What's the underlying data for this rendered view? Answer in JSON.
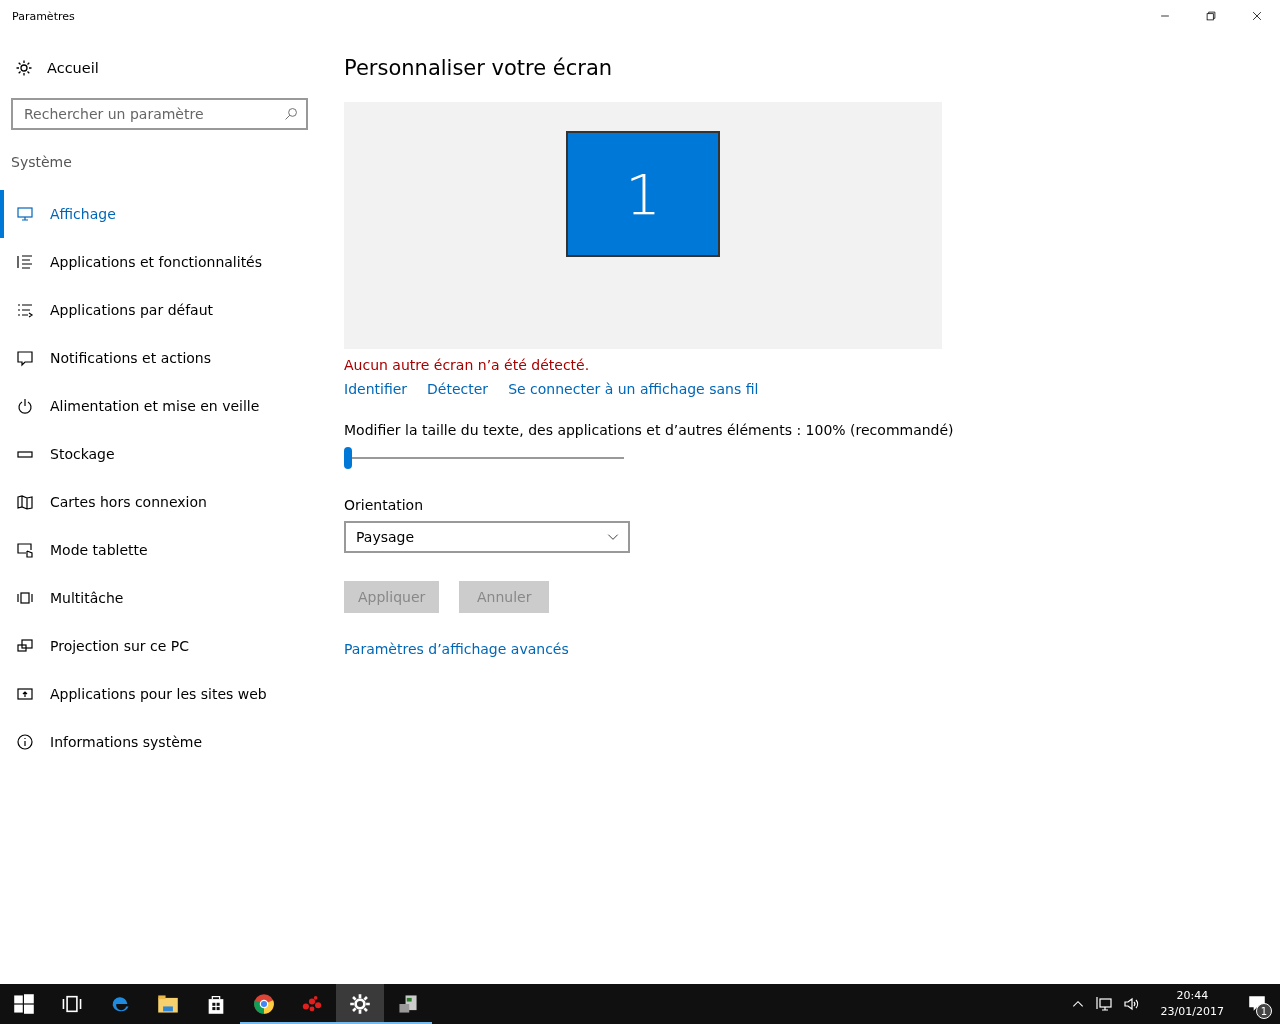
{
  "window": {
    "title": "Paramètres"
  },
  "sidebar": {
    "home": "Accueil",
    "search": {
      "placeholder": "Rechercher un paramètre"
    },
    "section": "Système",
    "items": [
      {
        "label": "Affichage",
        "selected": true
      },
      {
        "label": "Applications et fonctionnalités",
        "selected": false
      },
      {
        "label": "Applications par défaut",
        "selected": false
      },
      {
        "label": "Notifications et actions",
        "selected": false
      },
      {
        "label": "Alimentation et mise en veille",
        "selected": false
      },
      {
        "label": "Stockage",
        "selected": false
      },
      {
        "label": "Cartes hors connexion",
        "selected": false
      },
      {
        "label": "Mode tablette",
        "selected": false
      },
      {
        "label": "Multitâche",
        "selected": false
      },
      {
        "label": "Projection sur ce PC",
        "selected": false
      },
      {
        "label": "Applications pour les sites web",
        "selected": false
      },
      {
        "label": "Informations système",
        "selected": false
      }
    ]
  },
  "main": {
    "title": "Personnaliser votre écran",
    "monitors": [
      {
        "label": "1",
        "selected": true
      }
    ],
    "warning": "Aucun autre écran n’a été détecté.",
    "links": [
      "Identifier",
      "Détecter",
      "Se connecter à un affichage sans fil"
    ],
    "scale": {
      "label": "Modifier la taille du texte, des applications et d’autres éléments : 100% (recommandé)",
      "level": 0
    },
    "orientation": {
      "label": "Orientation",
      "value": "Paysage"
    },
    "buttons": [
      {
        "label": "Appliquer",
        "disabled": true
      },
      {
        "label": "Annuler",
        "disabled": true
      }
    ],
    "advanced_link": "Paramètres d’affichage avancés"
  },
  "taskbar": {
    "apps": [
      {
        "kind": "start",
        "running": false,
        "active": false
      },
      {
        "kind": "taskview",
        "running": false,
        "active": false
      },
      {
        "kind": "edge",
        "running": false,
        "active": false
      },
      {
        "kind": "explorer",
        "running": false,
        "active": false
      },
      {
        "kind": "store",
        "running": false,
        "active": false
      },
      {
        "kind": "chrome",
        "running": true,
        "active": false
      },
      {
        "kind": "dots",
        "running": true,
        "active": false
      },
      {
        "kind": "settings",
        "running": true,
        "active": true
      },
      {
        "kind": "box",
        "running": true,
        "active": false
      }
    ],
    "time": "20:44",
    "date": "23/01/2017",
    "notifications": "1"
  }
}
